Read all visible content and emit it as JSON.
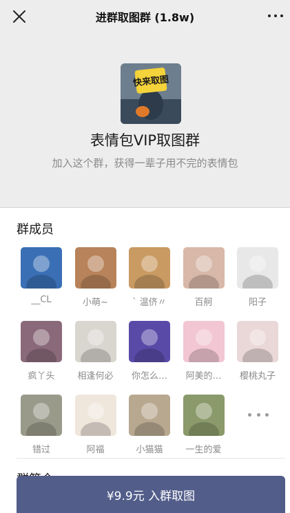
{
  "topbar": {
    "title": "进群取图群 (1.8w)"
  },
  "group": {
    "avatar_text": "快来取图",
    "name": "表情包VIP取图群",
    "description": "加入这个群，获得一辈子用不完的表情包"
  },
  "members": {
    "title": "群成员",
    "list": [
      {
        "name": "__CL",
        "color": "#3a6fb5"
      },
      {
        "name": "小萌~",
        "color": "#b8835a"
      },
      {
        "name": "` 温侪〃",
        "color": "#c99a62"
      },
      {
        "name": "百舸",
        "color": "#d8b8a8"
      },
      {
        "name": "阳子",
        "color": "#e8e8e8"
      },
      {
        "name": "疯丫头",
        "color": "#8a6a7a"
      },
      {
        "name": "相逢何必",
        "color": "#d9d5cf"
      },
      {
        "name": "你怎么…",
        "color": "#5a4aa8"
      },
      {
        "name": "阿美的…",
        "color": "#f2c6d3"
      },
      {
        "name": "樱桃丸子",
        "color": "#ead8d8"
      },
      {
        "name": "错过",
        "color": "#9a9a8a"
      },
      {
        "name": "阿福",
        "color": "#efe6dc"
      },
      {
        "name": "小猫猫",
        "color": "#b8a890"
      },
      {
        "name": "一生的爱",
        "color": "#8a9a6a"
      }
    ]
  },
  "intro": {
    "title": "群简介"
  },
  "join_button": {
    "label": "¥9.9元 入群取图"
  },
  "colors": {
    "background": "#ededed",
    "button": "#525d8a",
    "secondary_text": "#8a8a8a"
  }
}
